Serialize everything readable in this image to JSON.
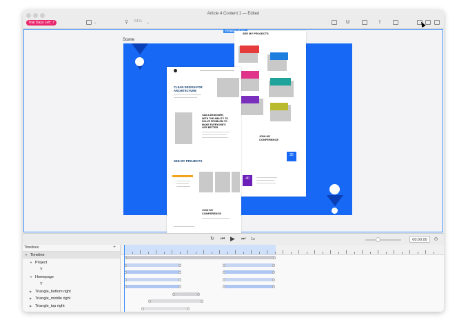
{
  "window": {
    "title": "Article 4 Content 1 — Edited",
    "trial_badge": "Trial Days Left: 7",
    "zoom": "51%"
  },
  "canvas": {
    "scene_label": "Scene",
    "responsive_badge": "Relative Mode",
    "scene_color": "#1668f5"
  },
  "page_left": {
    "hero_heading": "CLEAN DESIGN FOR\nARCHITECTURE",
    "designer_heading": "I AM A DESIGNER,\nWITH THE ABILITY TO\nSOLVE PROBLEM TO\nMAKE EVERYONE'S\nLIFE BETTER",
    "projects_heading": "SEE MY PROJECTS",
    "join_heading": "JOIN MY\nCONFERENCE"
  },
  "page_right": {
    "projects_heading": "SEE MY PROJECTS",
    "join_heading": "JOIN MY\nCONFERENCE",
    "date_number": "40",
    "date_number_2": "25"
  },
  "transport": {
    "rate": "1x",
    "time": "00:00.00"
  },
  "timelines": {
    "header": "Timelines",
    "add_icon": "+",
    "rows": [
      {
        "label": "Timeline",
        "indent": 0,
        "expanded": true,
        "selected": true
      },
      {
        "label": "Project",
        "indent": 1,
        "expanded": true
      },
      {
        "label": "Y",
        "indent": 2
      },
      {
        "label": "Homepage",
        "indent": 1,
        "expanded": true
      },
      {
        "label": "Y",
        "indent": 2
      },
      {
        "label": "Triangle_bottom right",
        "indent": 1,
        "expanded": false
      },
      {
        "label": "Triangle_middle right",
        "indent": 1,
        "expanded": false
      },
      {
        "label": "Triangle_top right",
        "indent": 1,
        "expanded": false
      }
    ]
  },
  "colors": {
    "accent": "#3b8ef5",
    "trial": "#e9276b"
  }
}
